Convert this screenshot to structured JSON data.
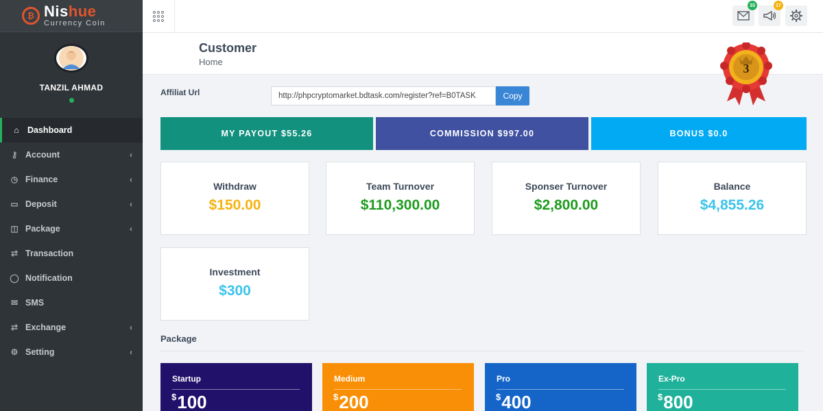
{
  "brand": {
    "name_main": "Nis",
    "name_accent": "hue",
    "subtitle": "Currency Coin"
  },
  "user": {
    "name": "TANZIL AHMAD",
    "status": "online"
  },
  "sidebar": {
    "items": [
      {
        "label": "Dashboard",
        "icon": "home-icon",
        "glyph": "⌂",
        "has_children": false,
        "active": true
      },
      {
        "label": "Account",
        "icon": "key-icon",
        "glyph": "⚷",
        "has_children": true
      },
      {
        "label": "Finance",
        "icon": "clock-icon",
        "glyph": "◷",
        "has_children": true
      },
      {
        "label": "Deposit",
        "icon": "credit-card-icon",
        "glyph": "▭",
        "has_children": true
      },
      {
        "label": "Package",
        "icon": "box-icon",
        "glyph": "◫",
        "has_children": true
      },
      {
        "label": "Transaction",
        "icon": "exchange-icon",
        "glyph": "⇄",
        "has_children": false
      },
      {
        "label": "Notification",
        "icon": "comment-icon",
        "glyph": "◯",
        "has_children": false
      },
      {
        "label": "SMS",
        "icon": "envelope-icon",
        "glyph": "✉",
        "has_children": false
      },
      {
        "label": "Exchange",
        "icon": "exchange-icon",
        "glyph": "⇄",
        "has_children": true
      },
      {
        "label": "Setting",
        "icon": "gear-icon",
        "glyph": "⚙",
        "has_children": true
      }
    ]
  },
  "topbar": {
    "messages_count": "33",
    "notifications_count": "17"
  },
  "header": {
    "title": "Customer",
    "subtitle": "Home",
    "rank": "3"
  },
  "affiliate": {
    "label": "Affiliat Url",
    "url": "http://phpcryptomarket.bdtask.com/register?ref=B0TASK",
    "copy_label": "Copy"
  },
  "stats_bars": [
    {
      "label": "MY PAYOUT $55.26",
      "color": "#13917f"
    },
    {
      "label": "COMMISSION $997.00",
      "color": "#3f51a0"
    },
    {
      "label": "BONUS $0.0",
      "color": "#02aaf3"
    }
  ],
  "cards": [
    {
      "title": "Withdraw",
      "value": "$150.00",
      "color": "#f5b312"
    },
    {
      "title": "Team Turnover",
      "value": "$110,300.00",
      "color": "#1c9b1c"
    },
    {
      "title": "Sponser Turnover",
      "value": "$2,800.00",
      "color": "#1c9b1c"
    },
    {
      "title": "Balance",
      "value": "$4,855.26",
      "color": "#3bc3ea"
    },
    {
      "title": "Investment",
      "value": "$300",
      "color": "#3bc3ea"
    }
  ],
  "packages_section": {
    "title": "Package"
  },
  "packages": [
    {
      "name": "Startup",
      "currency": "$",
      "price": "100",
      "color": "#22116a"
    },
    {
      "name": "Medium",
      "currency": "$",
      "price": "200",
      "color": "#f98f06"
    },
    {
      "name": "Pro",
      "currency": "$",
      "price": "400",
      "color": "#1565c9"
    },
    {
      "name": "Ex-Pro",
      "currency": "$",
      "price": "800",
      "color": "#1fb19a"
    }
  ]
}
